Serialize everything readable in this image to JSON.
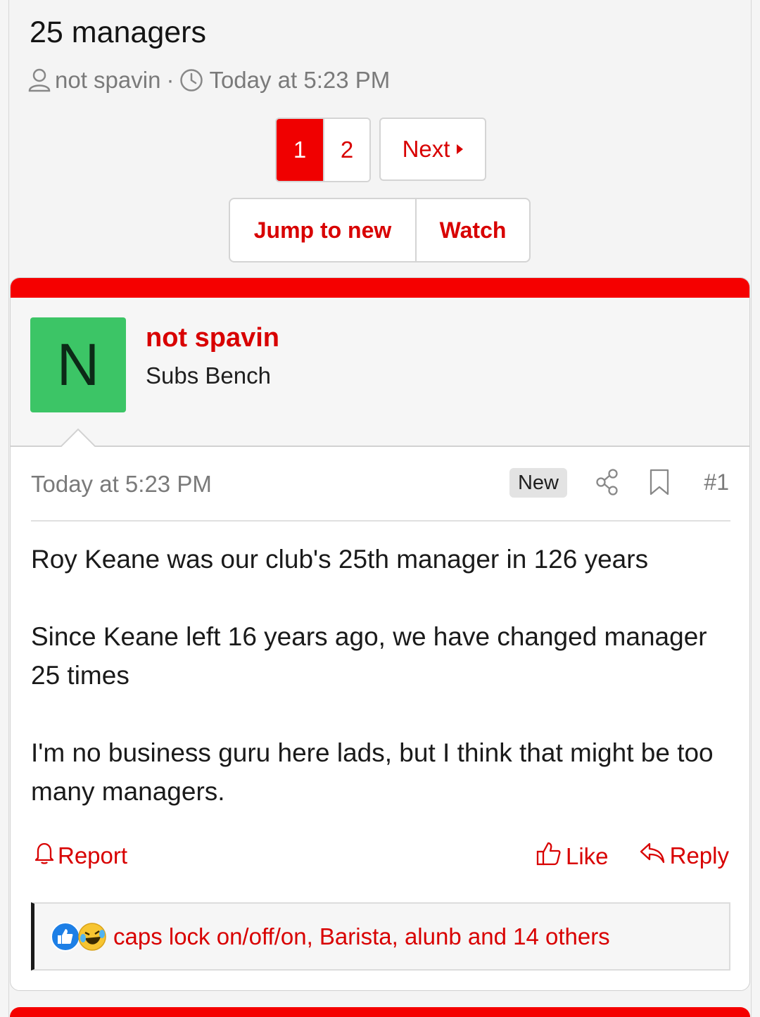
{
  "thread": {
    "title": "25 managers",
    "author": "not spavin",
    "separator": "·",
    "time": "Today at 5:23 PM"
  },
  "pagination": {
    "pages": [
      "1",
      "2"
    ],
    "current_page": "1",
    "next_label": "Next"
  },
  "actions": {
    "jump_label": "Jump to new",
    "watch_label": "Watch"
  },
  "post": {
    "avatar_letter": "N",
    "avatar_color": "#3cc566",
    "username": "not spavin",
    "user_title": "Subs Bench",
    "date": "Today at 5:23 PM",
    "badge": "New",
    "number": "#1",
    "paragraphs": [
      "Roy Keane was our club's 25th manager in 126 years",
      "Since Keane left 16 years ago, we have changed manager 25 times",
      "I'm no business guru here lads, but I think that might be too many managers."
    ],
    "report_label": "Report",
    "like_label": "Like",
    "reply_label": "Reply",
    "reactions_text": "caps lock on/off/on, Barista, alunb and 14 others",
    "reaction_icons": [
      "like-reaction-icon",
      "laugh-reaction-icon"
    ]
  },
  "colors": {
    "accent": "#d80000",
    "bar": "#f50000",
    "background": "#f4f4f4"
  }
}
